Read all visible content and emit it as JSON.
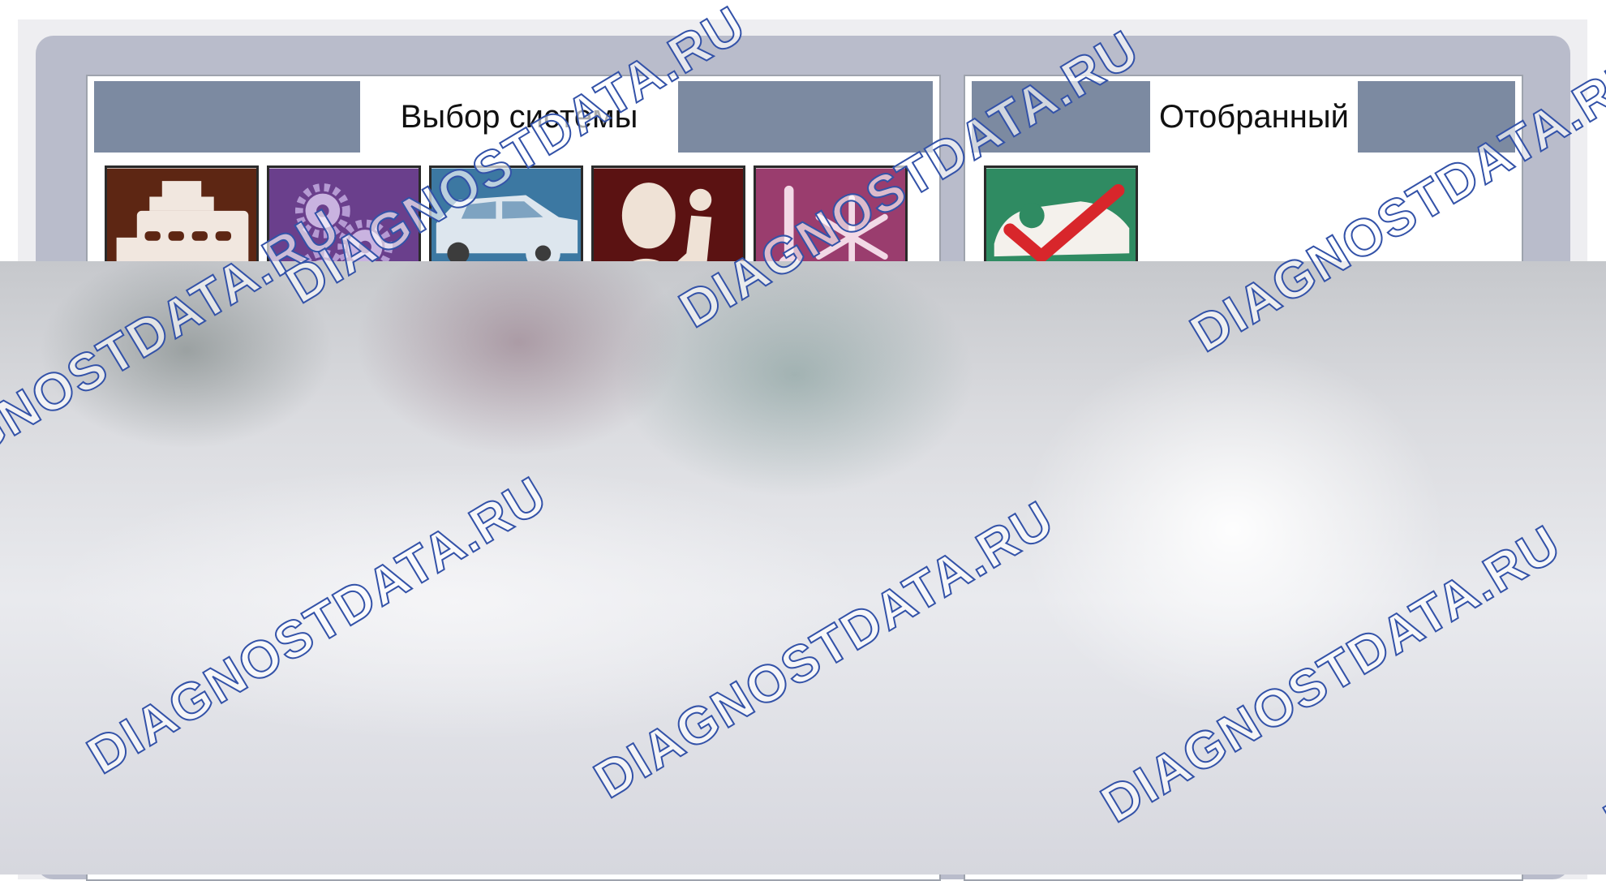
{
  "panels": {
    "system_select": {
      "title": "Выбор системы"
    },
    "selected": {
      "title": "Отобранный"
    }
  },
  "tiles": [
    {
      "icon": "engine-icon",
      "color": "#5d2613"
    },
    {
      "icon": "transmission-gears-icon",
      "color": "#6a3f8c"
    },
    {
      "icon": "car-chassis-icon",
      "color": "#3c78a2"
    },
    {
      "icon": "airbag-seat-icon",
      "color": "#5b1212"
    },
    {
      "icon": "climate-control-icon",
      "color": "#9a3d6e"
    }
  ],
  "selected_tiles": [
    {
      "icon": "car-checkmark-icon",
      "color": "#2f8b62"
    }
  ],
  "watermark": {
    "text": "DIAGNOSTDATA.RU",
    "color": "#3352a8"
  }
}
